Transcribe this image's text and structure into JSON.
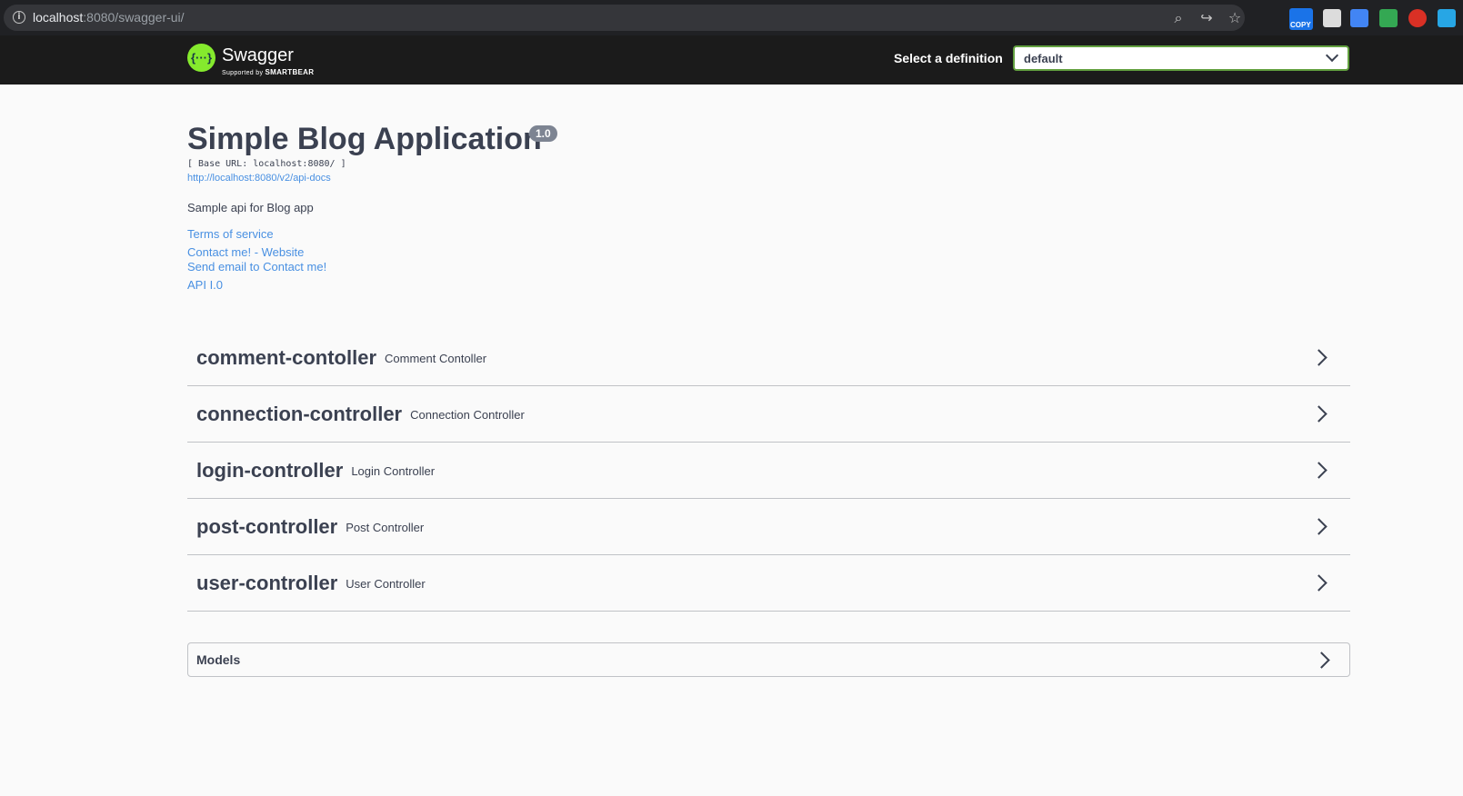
{
  "browser": {
    "url_host": "localhost",
    "url_rest": ":8080/swagger-ui/",
    "copy_ext_label": "COPY"
  },
  "topbar": {
    "logo_symbol": "{···}",
    "logo_name": "Swagger",
    "logo_supported": "Supported by",
    "logo_company": "SMARTBEAR",
    "select_label": "Select a definition",
    "select_value": "default"
  },
  "info": {
    "title": "Simple Blog Application",
    "version": "1.0",
    "base_url": "[ Base URL: localhost:8080/ ]",
    "spec_link": "http://localhost:8080/v2/api-docs",
    "description": "Sample api for Blog app",
    "terms": "Terms of service",
    "contact_website": "Contact me! - Website",
    "contact_email": "Send email to Contact me!",
    "api_version": "API I.0"
  },
  "tags": [
    {
      "name": "comment-contoller",
      "description": "Comment Contoller"
    },
    {
      "name": "connection-controller",
      "description": "Connection Controller"
    },
    {
      "name": "login-controller",
      "description": "Login Controller"
    },
    {
      "name": "post-controller",
      "description": "Post Controller"
    },
    {
      "name": "user-controller",
      "description": "User Controller"
    }
  ],
  "models": {
    "label": "Models"
  },
  "colors": {
    "swagger_green": "#85ea2d",
    "link_blue": "#4990e2",
    "topbar_bg": "#1b1b1b",
    "text_dark": "#3b4151"
  }
}
